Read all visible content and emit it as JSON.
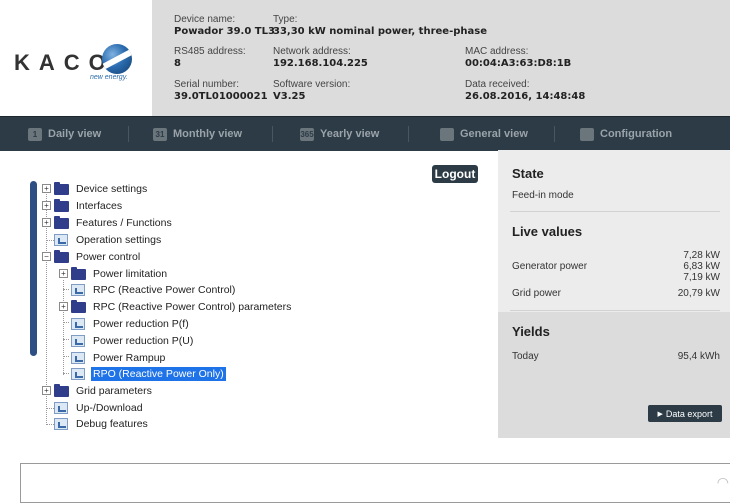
{
  "logo": {
    "brand": "KACO",
    "tagline": "new energy."
  },
  "device": {
    "name_label": "Device name:",
    "name_value": "Powador 39.0 TL3",
    "type_label": "Type:",
    "type_value": "33,30 kW nominal power, three-phase",
    "rs485_label": "RS485 address:",
    "rs485_value": "8",
    "network_label": "Network address:",
    "network_value": "192.168.104.225",
    "mac_label": "MAC address:",
    "mac_value": "00:04:A3:63:D8:1B",
    "serial_label": "Serial number:",
    "serial_value": "39.0TL01000021",
    "software_label": "Software version:",
    "software_value": "V3.25",
    "received_label": "Data received:",
    "received_value": "26.08.2016, 14:48:48"
  },
  "nav": {
    "daily": "Daily view",
    "monthly": "Monthly view",
    "yearly": "Yearly view",
    "general": "General view",
    "configuration": "Configuration"
  },
  "logout": "Logout",
  "tree": {
    "device_settings": "Device settings",
    "interfaces": "Interfaces",
    "features": "Features / Functions",
    "operation_settings": "Operation settings",
    "power_control": "Power control",
    "power_limitation": "Power limitation",
    "rpc": "RPC (Reactive Power Control)",
    "rpc_params": "RPC (Reactive Power Control) parameters",
    "reduction_pf": "Power reduction P(f)",
    "reduction_pu": "Power reduction P(U)",
    "rampup": "Power Rampup",
    "rpo": "RPO (Reactive Power Only)",
    "grid_params": "Grid parameters",
    "updownload": "Up-/Download",
    "debug": "Debug features"
  },
  "state": {
    "title": "State",
    "value": "Feed-in mode"
  },
  "live": {
    "title": "Live values",
    "generator_label": "Generator power",
    "generator_v1": "7,28 kW",
    "generator_v2": "6,83 kW",
    "generator_v3": "7,19 kW",
    "grid_label": "Grid power",
    "grid_value": "20,79 kW"
  },
  "yields": {
    "title": "Yields",
    "today_label": "Today",
    "today_value": "95,4 kWh"
  },
  "export_button": "Data export",
  "colors": {
    "navbar": "#2c3b46",
    "selected": "#1f73e8",
    "folder": "#2f3d8a",
    "panel": "#ececec"
  }
}
